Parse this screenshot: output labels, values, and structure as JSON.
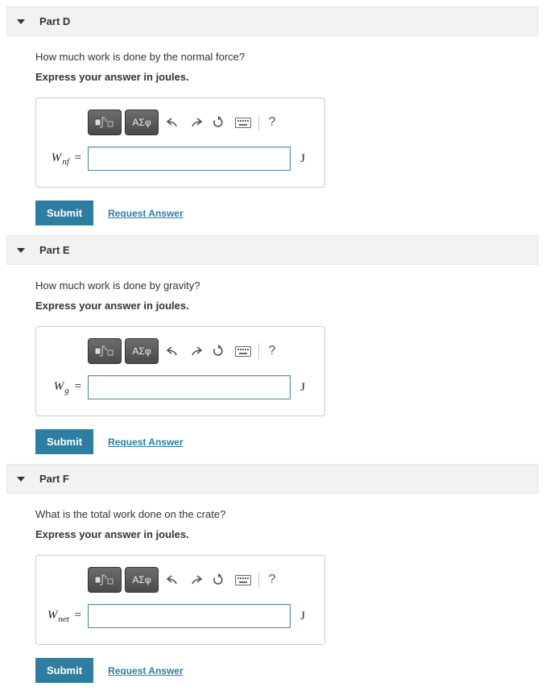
{
  "parts": [
    {
      "id": "d",
      "title": "Part D",
      "question": "How much work is done by the normal force?",
      "instruction": "Express your answer in joules.",
      "var_html": "W<span class='sub'>nf</span>",
      "unit": "J",
      "submit": "Submit",
      "request": "Request Answer"
    },
    {
      "id": "e",
      "title": "Part E",
      "question": "How much work is done by gravity?",
      "instruction": "Express your answer in joules.",
      "var_html": "W<span class='sub'>g</span>",
      "unit": "J",
      "submit": "Submit",
      "request": "Request Answer"
    },
    {
      "id": "f",
      "title": "Part F",
      "question": "What is the total work done on the crate?",
      "instruction": "Express your answer in joules.",
      "var_html": "W<span class='sub'>net</span>",
      "unit": "J",
      "submit": "Submit",
      "request": "Request Answer"
    }
  ],
  "toolbar": {
    "greek_label": "ΑΣφ"
  }
}
